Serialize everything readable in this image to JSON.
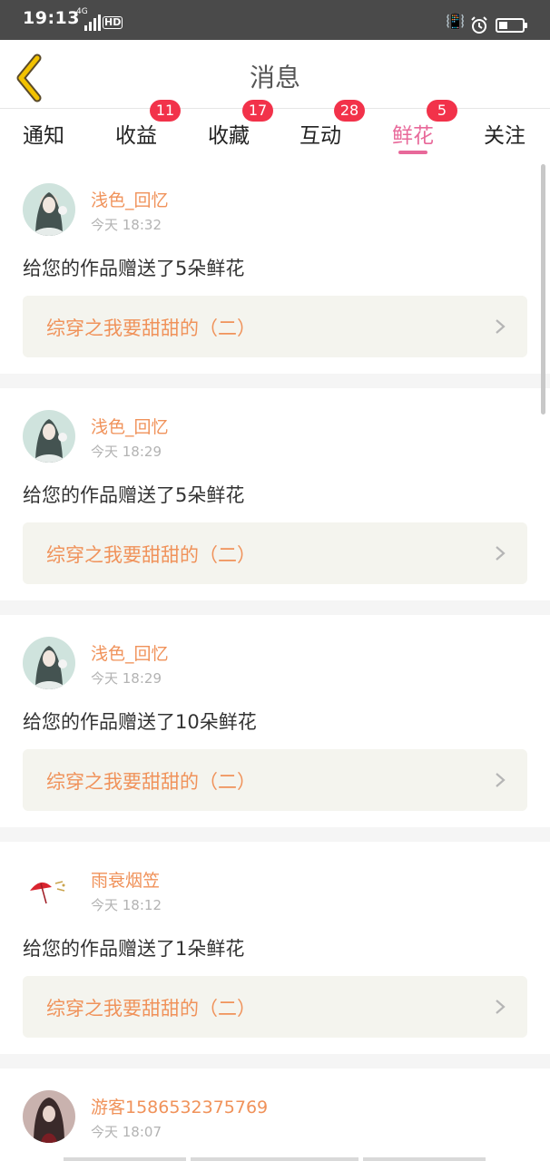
{
  "status_bar": {
    "time": "19:13",
    "network": "4G",
    "hd": "HD"
  },
  "header": {
    "title": "消息"
  },
  "tabs": [
    {
      "label": "通知",
      "badge": null
    },
    {
      "label": "收益",
      "badge": "11"
    },
    {
      "label": "收藏",
      "badge": "17"
    },
    {
      "label": "互动",
      "badge": "28"
    },
    {
      "label": "鲜花",
      "badge": "5",
      "active": true
    },
    {
      "label": "关注",
      "badge": null
    }
  ],
  "messages": [
    {
      "username": "浅色_回忆",
      "time": "今天 18:32",
      "text": "给您的作品赠送了5朵鲜花",
      "work": "综穿之我要甜甜的（二）",
      "avatar": "girl-portrait-avatar"
    },
    {
      "username": "浅色_回忆",
      "time": "今天 18:29",
      "text": "给您的作品赠送了5朵鲜花",
      "work": "综穿之我要甜甜的（二）",
      "avatar": "girl-portrait-avatar"
    },
    {
      "username": "浅色_回忆",
      "time": "今天 18:29",
      "text": "给您的作品赠送了10朵鲜花",
      "work": "综穿之我要甜甜的（二）",
      "avatar": "girl-portrait-avatar"
    },
    {
      "username": "雨衰烟笠",
      "time": "今天 18:12",
      "text": "给您的作品赠送了1朵鲜花",
      "work": "综穿之我要甜甜的（二）",
      "avatar": "red-umbrella-avatar"
    },
    {
      "username": "游客1586532375769",
      "time": "今天 18:07",
      "avatar": "dark-hair-avatar"
    }
  ],
  "colors": {
    "accent": "#e8699a",
    "username": "#f0925a",
    "badge": "#f2324a",
    "back_arrow": "#f2c200",
    "work_bg": "#f4f4ee"
  },
  "icons": {
    "back": "back-chevron-icon",
    "chevron": "chevron-right-icon"
  }
}
